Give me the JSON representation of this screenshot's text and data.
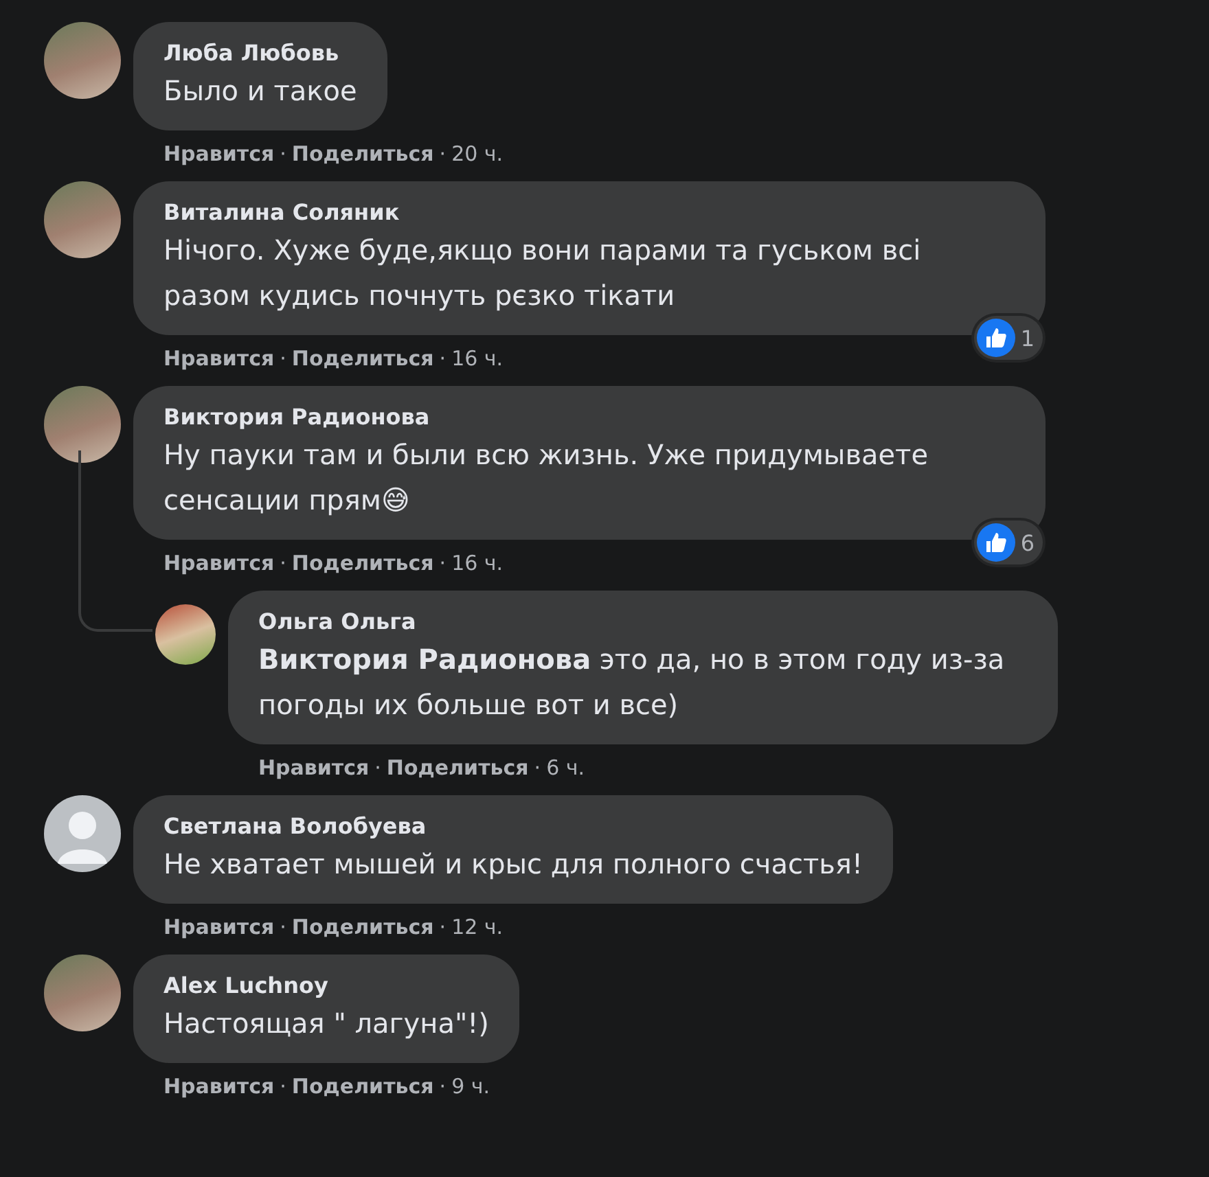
{
  "comments": [
    {
      "author": "Люба Любовь",
      "photo": true,
      "text": "Было и такое",
      "footer": [
        {
          "kind": "link",
          "text": "Нравится"
        },
        {
          "kind": "sep",
          "text": "·"
        },
        {
          "kind": "link",
          "text": "Поделиться"
        },
        {
          "kind": "sep",
          "text": "·"
        },
        {
          "kind": "time",
          "text": "20 ч."
        }
      ]
    },
    {
      "author": "Виталина Соляник",
      "photo": true,
      "text": "Нічого. Хуже буде,якщо вони парами та гуськом всі разом кудись почнуть рєзко тікати",
      "footer": [
        {
          "kind": "link",
          "text": "Нравится"
        },
        {
          "kind": "sep",
          "text": "·"
        },
        {
          "kind": "link",
          "text": "Поделиться"
        },
        {
          "kind": "sep",
          "text": "·"
        },
        {
          "kind": "time",
          "text": "16 ч."
        }
      ],
      "reaction": {
        "kind": "like",
        "count": "1"
      }
    },
    {
      "author": "Виктория Радионова",
      "photo": true,
      "text": "Ну пауки там и были всю жизнь. Уже придумываете сенсации прям😅",
      "footer": [
        {
          "kind": "link",
          "text": "Нравится"
        },
        {
          "kind": "sep",
          "text": "·"
        },
        {
          "kind": "link",
          "text": "Поделиться"
        },
        {
          "kind": "sep",
          "text": "·"
        },
        {
          "kind": "time",
          "text": "16 ч."
        }
      ],
      "reaction": {
        "kind": "like",
        "count": "6"
      },
      "children": [
        {
          "author": "Ольга Ольга",
          "photo": true,
          "text": "**Виктория Радионова** это да, но в этом году из-за погоды их больше вот и все)",
          "footer": [
            {
              "kind": "link",
              "text": "Нравится"
            },
            {
              "kind": "sep",
              "text": "·"
            },
            {
              "kind": "link",
              "text": "Поделиться"
            },
            {
              "kind": "sep",
              "text": "·"
            },
            {
              "kind": "time",
              "text": "6 ч."
            }
          ]
        }
      ]
    },
    {
      "author": "Светлана Волобуева",
      "photo": false,
      "text": "Не хватает мышей и крыс для полного счастья!",
      "footer": [
        {
          "kind": "link",
          "text": "Нравится"
        },
        {
          "kind": "sep",
          "text": "·"
        },
        {
          "kind": "link",
          "text": "Поделиться"
        },
        {
          "kind": "sep",
          "text": "·"
        },
        {
          "kind": "time",
          "text": "12 ч."
        }
      ]
    },
    {
      "author": "Alex Luchnoy",
      "photo": true,
      "text": "Настоящая \" лагуна\"!)",
      "footer": [
        {
          "kind": "link",
          "text": "Нравится"
        },
        {
          "kind": "sep",
          "text": "·"
        },
        {
          "kind": "link",
          "text": "Поделиться"
        },
        {
          "kind": "sep",
          "text": "·"
        },
        {
          "kind": "time",
          "text": "9 ч."
        }
      ]
    }
  ]
}
